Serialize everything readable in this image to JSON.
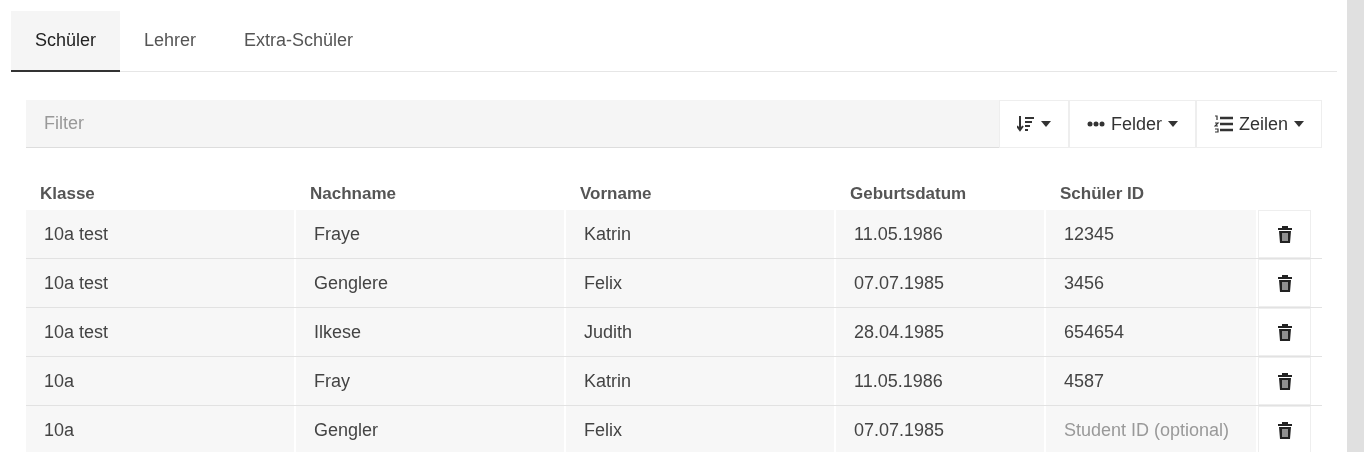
{
  "tabs": [
    {
      "label": "Schüler",
      "selected": true
    },
    {
      "label": "Lehrer",
      "selected": false
    },
    {
      "label": "Extra-Schüler",
      "selected": false
    }
  ],
  "filter": {
    "placeholder": "Filter"
  },
  "toolbar": [
    {
      "kind": "sort"
    },
    {
      "kind": "fields",
      "label": "Felder"
    },
    {
      "kind": "rows",
      "label": "Zeilen"
    }
  ],
  "table": {
    "columns": [
      "Klasse",
      "Nachname",
      "Vorname",
      "Geburtsdatum",
      "Schüler ID"
    ],
    "rows": [
      {
        "cells": [
          {
            "value": "10a test"
          },
          {
            "value": "Fraye"
          },
          {
            "value": "Katrin"
          },
          {
            "value": "11.05.1986"
          },
          {
            "value": "12345"
          }
        ]
      },
      {
        "cells": [
          {
            "value": "10a test"
          },
          {
            "value": "Genglere"
          },
          {
            "value": "Felix"
          },
          {
            "value": "07.07.1985"
          },
          {
            "value": "3456"
          }
        ]
      },
      {
        "cells": [
          {
            "value": "10a test"
          },
          {
            "value": "Ilkese"
          },
          {
            "value": "Judith"
          },
          {
            "value": "28.04.1985"
          },
          {
            "value": "654654"
          }
        ]
      },
      {
        "cells": [
          {
            "value": "10a"
          },
          {
            "value": "Fray"
          },
          {
            "value": "Katrin"
          },
          {
            "value": "11.05.1986"
          },
          {
            "value": "4587"
          }
        ]
      },
      {
        "cells": [
          {
            "value": "10a"
          },
          {
            "value": "Gengler"
          },
          {
            "value": "Felix"
          },
          {
            "value": "07.07.1985"
          },
          {
            "placeholder": "Student ID (optional)"
          }
        ]
      }
    ]
  }
}
